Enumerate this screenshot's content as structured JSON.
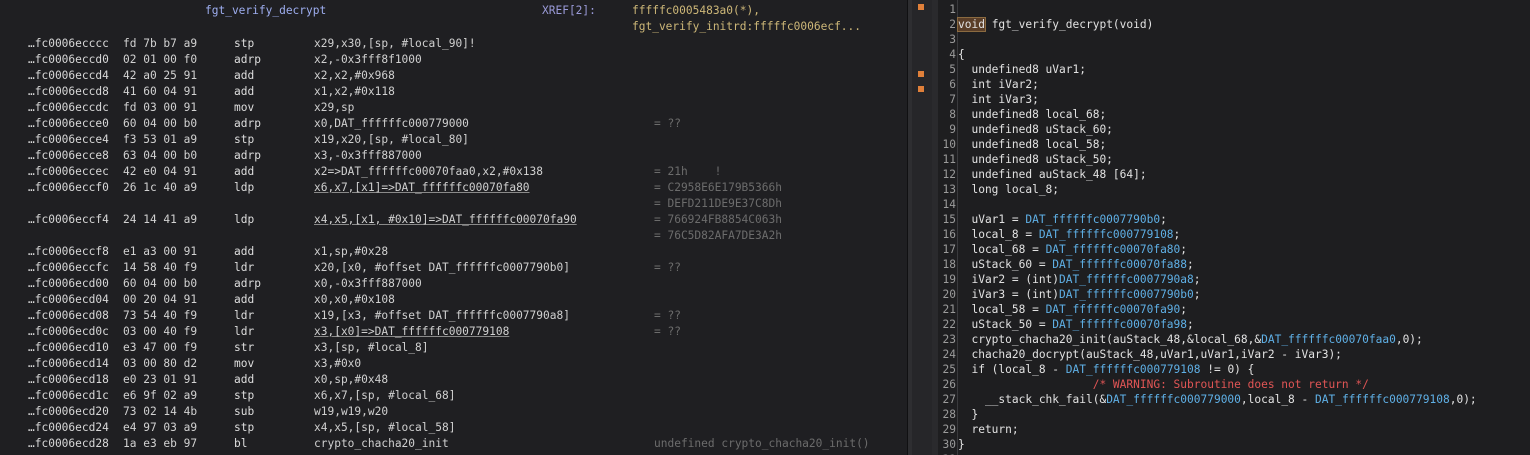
{
  "listing": {
    "header": {
      "function_name": "fgt_verify_decrypt",
      "xref_label": "XREF[2]:",
      "xref_1": "fffffc0005483a0(*),",
      "xref_2": "fgt_verify_initrd:fffffc0006ecf..."
    },
    "rows": [
      {
        "addr": "…fc0006ecccc",
        "bytes": "fd 7b b7 a9",
        "mn": "stp",
        "op": "x29,x30,[sp, #local_90]!",
        "cmt": ""
      },
      {
        "addr": "…fc0006eccd0",
        "bytes": "02 01 00 f0",
        "mn": "adrp",
        "op": "x2,-0x3fff8f1000",
        "cmt": ""
      },
      {
        "addr": "…fc0006eccd4",
        "bytes": "42 a0 25 91",
        "mn": "add",
        "op": "x2,x2,#0x968",
        "cmt": ""
      },
      {
        "addr": "…fc0006eccd8",
        "bytes": "41 60 04 91",
        "mn": "add",
        "op": "x1,x2,#0x118",
        "cmt": ""
      },
      {
        "addr": "…fc0006eccdc",
        "bytes": "fd 03 00 91",
        "mn": "mov",
        "op": "x29,sp",
        "cmt": ""
      },
      {
        "addr": "…fc0006ecce0",
        "bytes": "60 04 00 b0",
        "mn": "adrp",
        "op": "x0,DAT_ffffffc000779000",
        "cmt": "= ??"
      },
      {
        "addr": "…fc0006ecce4",
        "bytes": "f3 53 01 a9",
        "mn": "stp",
        "op": "x19,x20,[sp, #local_80]",
        "cmt": ""
      },
      {
        "addr": "…fc0006ecce8",
        "bytes": "63 04 00 b0",
        "mn": "adrp",
        "op": "x3,-0x3fff887000",
        "cmt": ""
      },
      {
        "addr": "…fc0006eccec",
        "bytes": "42 e0 04 91",
        "mn": "add",
        "op": "x2=>DAT_ffffffc00070faa0,x2,#0x138",
        "cmt": "= 21h    !"
      },
      {
        "addr": "…fc0006eccf0",
        "bytes": "26 1c 40 a9",
        "mn": "ldp",
        "op": "x6,x7,[x1]=>DAT_ffffffc00070fa80",
        "cmt": "= C2958E6E179B5366h"
      },
      {
        "addr": "",
        "bytes": "",
        "mn": "",
        "op": "",
        "cmt": "= DEFD211DE9E37C8Dh"
      },
      {
        "addr": "…fc0006eccf4",
        "bytes": "24 14 41 a9",
        "mn": "ldp",
        "op": "x4,x5,[x1, #0x10]=>DAT_ffffffc00070fa90",
        "cmt": "= 766924FB8854C063h"
      },
      {
        "addr": "",
        "bytes": "",
        "mn": "",
        "op": "",
        "cmt": "= 76C5D82AFA7DE3A2h"
      },
      {
        "addr": "…fc0006eccf8",
        "bytes": "e1 a3 00 91",
        "mn": "add",
        "op": "x1,sp,#0x28",
        "cmt": ""
      },
      {
        "addr": "…fc0006eccfc",
        "bytes": "14 58 40 f9",
        "mn": "ldr",
        "op": "x20,[x0, #offset DAT_ffffffc0007790b0]",
        "cmt": "= ??"
      },
      {
        "addr": "…fc0006ecd00",
        "bytes": "60 04 00 b0",
        "mn": "adrp",
        "op": "x0,-0x3fff887000",
        "cmt": ""
      },
      {
        "addr": "…fc0006ecd04",
        "bytes": "00 20 04 91",
        "mn": "add",
        "op": "x0,x0,#0x108",
        "cmt": ""
      },
      {
        "addr": "…fc0006ecd08",
        "bytes": "73 54 40 f9",
        "mn": "ldr",
        "op": "x19,[x3, #offset DAT_ffffffc0007790a8]",
        "cmt": "= ??"
      },
      {
        "addr": "…fc0006ecd0c",
        "bytes": "03 00 40 f9",
        "mn": "ldr",
        "op": "x3,[x0]=>DAT_ffffffc000779108",
        "cmt": "= ??"
      },
      {
        "addr": "…fc0006ecd10",
        "bytes": "e3 47 00 f9",
        "mn": "str",
        "op": "x3,[sp, #local_8]",
        "cmt": ""
      },
      {
        "addr": "…fc0006ecd14",
        "bytes": "03 00 80 d2",
        "mn": "mov",
        "op": "x3,#0x0",
        "cmt": ""
      },
      {
        "addr": "…fc0006ecd18",
        "bytes": "e0 23 01 91",
        "mn": "add",
        "op": "x0,sp,#0x48",
        "cmt": ""
      },
      {
        "addr": "…fc0006ecd1c",
        "bytes": "e6 9f 02 a9",
        "mn": "stp",
        "op": "x6,x7,[sp, #local_68]",
        "cmt": ""
      },
      {
        "addr": "…fc0006ecd20",
        "bytes": "73 02 14 4b",
        "mn": "sub",
        "op": "w19,w19,w20",
        "cmt": ""
      },
      {
        "addr": "…fc0006ecd24",
        "bytes": "e4 97 03 a9",
        "mn": "stp",
        "op": "x4,x5,[sp, #local_58]",
        "cmt": ""
      },
      {
        "addr": "…fc0006ecd28",
        "bytes": "1a e3 eb 97",
        "mn": "bl",
        "op": "crypto_chacha20_init",
        "cmt": "undefined crypto_chacha20_init()"
      }
    ]
  },
  "decompiler": {
    "lines": [
      {
        "n": "1",
        "t": ""
      },
      {
        "n": "2",
        "t": "void fgt_verify_decrypt(void)"
      },
      {
        "n": "3",
        "t": ""
      },
      {
        "n": "4",
        "t": "{"
      },
      {
        "n": "5",
        "t": "  undefined8 uVar1;"
      },
      {
        "n": "6",
        "t": "  int iVar2;"
      },
      {
        "n": "7",
        "t": "  int iVar3;"
      },
      {
        "n": "8",
        "t": "  undefined8 local_68;"
      },
      {
        "n": "9",
        "t": "  undefined8 uStack_60;"
      },
      {
        "n": "10",
        "t": "  undefined8 local_58;"
      },
      {
        "n": "11",
        "t": "  undefined8 uStack_50;"
      },
      {
        "n": "12",
        "t": "  undefined auStack_48 [64];"
      },
      {
        "n": "13",
        "t": "  long local_8;"
      },
      {
        "n": "14",
        "t": ""
      },
      {
        "n": "15",
        "t": "  uVar1 = DAT_ffffffc0007790b0;"
      },
      {
        "n": "16",
        "t": "  local_8 = DAT_ffffffc000779108;"
      },
      {
        "n": "17",
        "t": "  local_68 = DAT_ffffffc00070fa80;"
      },
      {
        "n": "18",
        "t": "  uStack_60 = DAT_ffffffc00070fa88;"
      },
      {
        "n": "19",
        "t": "  iVar2 = (int)DAT_ffffffc0007790a8;"
      },
      {
        "n": "20",
        "t": "  iVar3 = (int)DAT_ffffffc0007790b0;"
      },
      {
        "n": "21",
        "t": "  local_58 = DAT_ffffffc00070fa90;"
      },
      {
        "n": "22",
        "t": "  uStack_50 = DAT_ffffffc00070fa98;"
      },
      {
        "n": "23",
        "t": "  crypto_chacha20_init(auStack_48,&local_68,&DAT_ffffffc00070faa0,0);"
      },
      {
        "n": "24",
        "t": "  chacha20_docrypt(auStack_48,uVar1,uVar1,iVar2 - iVar3);"
      },
      {
        "n": "25",
        "t": "  if (local_8 - DAT_ffffffc000779108 != 0) {"
      },
      {
        "n": "26",
        "t": "                    /* WARNING: Subroutine does not return */"
      },
      {
        "n": "27",
        "t": "    __stack_chk_fail(&DAT_ffffffc000779000,local_8 - DAT_ffffffc000779108,0);"
      },
      {
        "n": "28",
        "t": "  }"
      },
      {
        "n": "29",
        "t": "  return;"
      },
      {
        "n": "30",
        "t": "}"
      },
      {
        "n": "31",
        "t": ""
      }
    ]
  },
  "colors": {
    "background": "#1e1e21",
    "global_ref": "#5fb0e6",
    "warning": "#e05555",
    "marker": "#e0803a",
    "xref": "#cdb778"
  }
}
